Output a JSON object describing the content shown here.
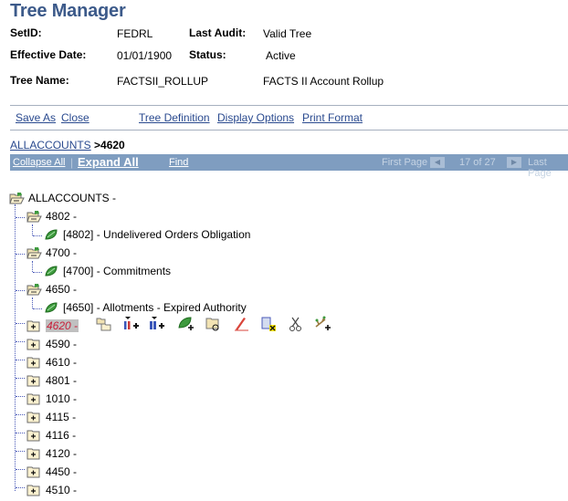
{
  "page": {
    "title": "Tree Manager"
  },
  "header": {
    "setid_label": "SetID:",
    "setid_value": "FEDRL",
    "last_audit_label": "Last Audit:",
    "last_audit_value": "Valid Tree",
    "effective_date_label": "Effective Date:",
    "effective_date_value": "01/01/1900",
    "status_label": "Status:",
    "status_value": "Active",
    "tree_name_label": "Tree Name:",
    "tree_name_value": "FACTSII_ROLLUP",
    "tree_description": "FACTS II Account Rollup"
  },
  "toolbar": {
    "save_as": "Save As",
    "close": "Close",
    "tree_definition": "Tree Definition",
    "display_options": "Display Options",
    "print_format": "Print Format"
  },
  "breadcrumb": {
    "root": "ALLACCOUNTS",
    "current": ">4620"
  },
  "navbar": {
    "collapse_all": "Collapse All",
    "separator": "|",
    "expand_all": "Expand All",
    "find": "Find",
    "first_page": "First Page",
    "page_indicator": "17 of 27",
    "last_page": "Last Page"
  },
  "tree": {
    "root": {
      "label": "ALLACCOUNTS -",
      "icon": "open-folder-icon"
    },
    "nodes": [
      {
        "label": "4802 -",
        "type": "open-node",
        "icon": "open-folder-icon"
      },
      {
        "label": "[4802] - Undelivered Orders Obligation",
        "type": "leaf",
        "icon": "leaf-icon"
      },
      {
        "label": "4700 -",
        "type": "open-node",
        "icon": "open-folder-icon"
      },
      {
        "label": "[4700] - Commitments",
        "type": "leaf",
        "icon": "leaf-icon"
      },
      {
        "label": "4650 -",
        "type": "open-node",
        "icon": "open-folder-icon"
      },
      {
        "label": "[4650] - Allotments - Expired Authority",
        "type": "leaf",
        "icon": "leaf-icon"
      },
      {
        "label": "4620 -",
        "type": "selected-node",
        "icon": "expand-folder-icon"
      },
      {
        "label": "4590 -",
        "type": "collapsed-node",
        "icon": "expand-folder-icon"
      },
      {
        "label": "4610 -",
        "type": "collapsed-node",
        "icon": "expand-folder-icon"
      },
      {
        "label": "4801 -",
        "type": "collapsed-node",
        "icon": "expand-folder-icon"
      },
      {
        "label": "1010 -",
        "type": "collapsed-node",
        "icon": "expand-folder-icon"
      },
      {
        "label": "4115 -",
        "type": "collapsed-node",
        "icon": "expand-folder-icon"
      },
      {
        "label": "4116 -",
        "type": "collapsed-node",
        "icon": "expand-folder-icon"
      },
      {
        "label": "4120 -",
        "type": "collapsed-node",
        "icon": "expand-folder-icon"
      },
      {
        "label": "4450 -",
        "type": "collapsed-node",
        "icon": "expand-folder-icon"
      },
      {
        "label": "4510 -",
        "type": "collapsed-node",
        "icon": "expand-folder-icon"
      }
    ],
    "node_tools": [
      "insert-sibling-node-icon",
      "insert-child-node-icon",
      "insert-child-node-below-icon",
      "insert-detail-icon",
      "cut-paste-node-icon",
      "edit-node-icon",
      "delete-node-icon",
      "cut-icon",
      "insert-branch-icon"
    ]
  },
  "colors": {
    "title": "#3c5a8a",
    "link": "#2a4a8f",
    "navbar_bg": "#7f9dc0",
    "selected_text": "#c8203a",
    "selected_bg": "#c0c0c0",
    "tree_lines": "#4a5ab8"
  }
}
